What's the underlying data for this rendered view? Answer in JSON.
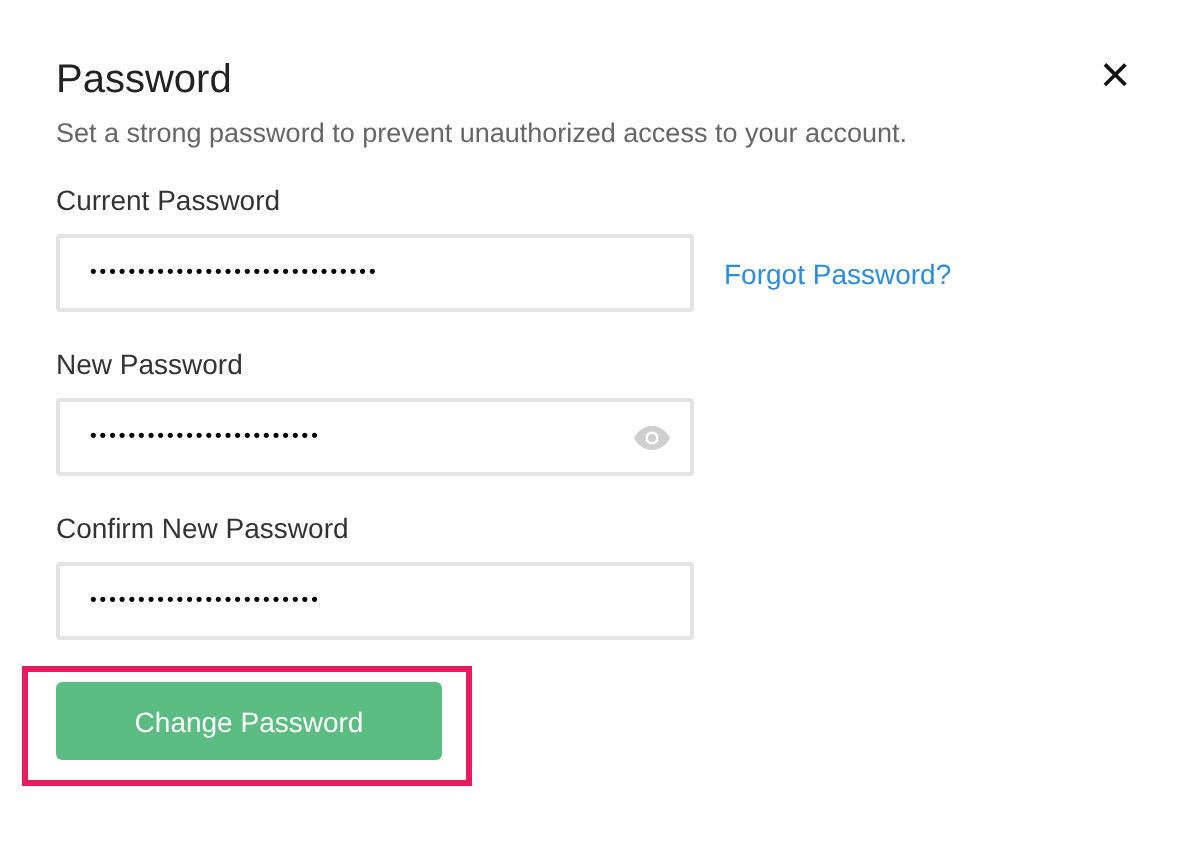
{
  "dialog": {
    "title": "Password",
    "subtitle": "Set a strong password to prevent unauthorized access to your account.",
    "close": "×"
  },
  "fields": [
    {
      "kind": "plain",
      "label": "Current Password",
      "value": "••••••••••••••••••••••••••••••",
      "link": "Forgot Password?"
    },
    {
      "kind": "reveal",
      "label": "New Password",
      "value": "••••••••••••••••••••••••"
    },
    {
      "kind": "plain",
      "label": "Confirm New Password",
      "value": "••••••••••••••••••••••••"
    }
  ],
  "submit": {
    "label": "Change Password",
    "highlighted": true
  }
}
